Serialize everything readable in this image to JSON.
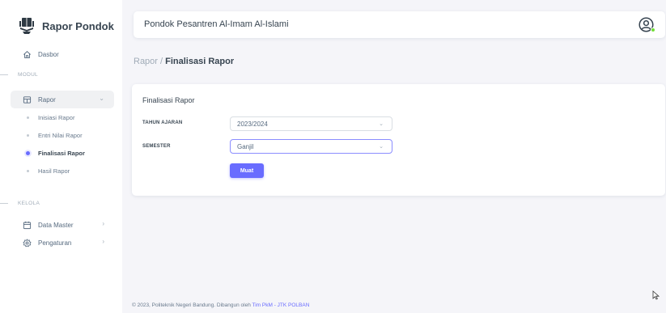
{
  "brand": {
    "name": "Rapor Pondok"
  },
  "sidebar": {
    "dashboard": "Dasbor",
    "section_modul": "MODUL",
    "rapor": {
      "label": "Rapor",
      "children": [
        "Inisiasi Rapor",
        "Entri Nilai Rapor",
        "Finalisasi Rapor",
        "Hasil Rapor"
      ],
      "active_child": "Finalisasi Rapor"
    },
    "section_kelola": "KELOLA",
    "data_master": "Data Master",
    "pengaturan": "Pengaturan"
  },
  "navbar": {
    "title": "Pondok Pesantren Al-Imam Al-Islami"
  },
  "breadcrumb": {
    "parent": "Rapor /",
    "current": "Finalisasi Rapor"
  },
  "card": {
    "title": "Finalisasi Rapor",
    "tahun_ajaran": {
      "label": "TAHUN AJARAN",
      "value": "2023/2024"
    },
    "semester": {
      "label": "SEMESTER",
      "value": "Ganjil"
    },
    "button": "Muat"
  },
  "footer": {
    "text": "© 2023, Politeknik Negeri Bandung. Dibangun oleh ",
    "link": "Tim PkM - JTK POLBAN"
  },
  "colors": {
    "primary": "#696cff",
    "text": "#566a7f",
    "heading": "#384551",
    "muted": "#a1acb8",
    "background": "#f5f5f9",
    "online": "#71dd37"
  },
  "icons": {
    "brand": "quran-stand-icon",
    "dashboard": "home-icon",
    "rapor": "table-icon",
    "data_master": "calendar-icon",
    "pengaturan": "gear-icon",
    "profile": "user-circle-icon"
  }
}
